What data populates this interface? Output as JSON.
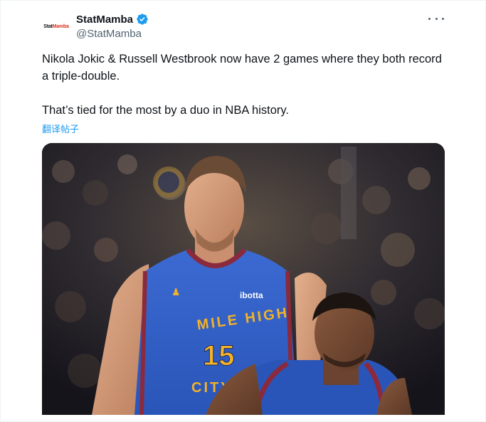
{
  "author": {
    "display_name": "StatMamba",
    "handle": "@StatMamba",
    "avatar_text_main": "Stat",
    "avatar_text_accent": "Mamba",
    "verified": true
  },
  "tweet": {
    "paragraphs": [
      "Nikola Jokic & Russell Westbrook now have 2 games where they both record a triple-double.",
      "That’s tied for the most by a duo in NBA history."
    ],
    "translate_label": "翻译帖子"
  },
  "media": {
    "jersey_wordmark": "ibotta",
    "jersey_line1": "MILE HIGH",
    "jersey_number": "15",
    "jersey_line2": "CITY"
  },
  "colors": {
    "link": "#1d9bf0",
    "verified": "#1d9bf0",
    "secondary_text": "#536471",
    "jersey_blue": "#2f5ec4",
    "jersey_gold": "#f2b229",
    "jersey_trim": "#8a2a3c"
  }
}
